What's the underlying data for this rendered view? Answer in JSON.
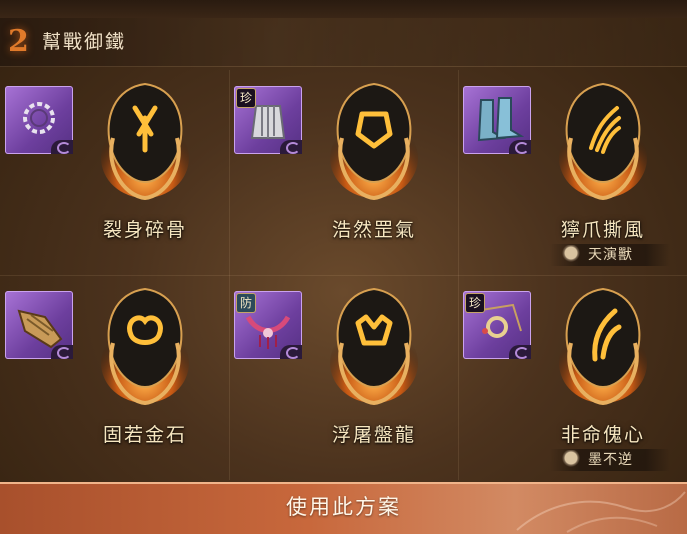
{
  "header": {
    "number": "2",
    "title": "幫戰御鐵"
  },
  "cells": [
    {
      "name": "裂身碎骨",
      "badge": "",
      "tag": ""
    },
    {
      "name": "浩然罡氣",
      "badge": "珍",
      "tag": ""
    },
    {
      "name": "獰爪撕風",
      "badge": "",
      "tag": "天演獸"
    },
    {
      "name": "固若金石",
      "badge": "",
      "tag": ""
    },
    {
      "name": "浮屠盤龍",
      "badge": "防",
      "tag": ""
    },
    {
      "name": "非命傀心",
      "badge": "珍",
      "tag": "墨不逆"
    }
  ],
  "footer": {
    "button_label": "使用此方案"
  },
  "colors": {
    "accent": "#e07a2a",
    "card": "#8a56c0",
    "footer": "#c8683c"
  }
}
